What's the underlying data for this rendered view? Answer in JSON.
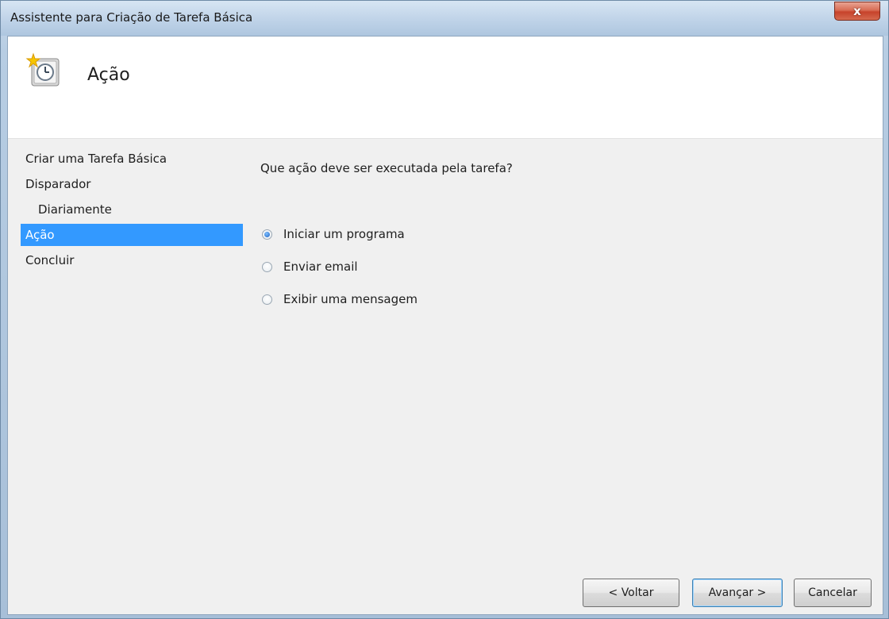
{
  "window": {
    "title": "Assistente para Criação de Tarefa Básica",
    "close_label": "x"
  },
  "header": {
    "icon": "task-clock-icon",
    "title": "Ação"
  },
  "nav": {
    "items": [
      {
        "label": "Criar uma Tarefa Básica",
        "active": false
      },
      {
        "label": "Disparador",
        "active": false
      },
      {
        "label": "Diariamente",
        "active": false
      },
      {
        "label": "Ação",
        "active": true
      },
      {
        "label": "Concluir",
        "active": false
      }
    ]
  },
  "main": {
    "question": "Que ação deve ser executada pela tarefa?",
    "options": [
      {
        "label": "Iniciar um programa",
        "checked": true
      },
      {
        "label": "Enviar email",
        "checked": false
      },
      {
        "label": "Exibir uma mensagem",
        "checked": false
      }
    ]
  },
  "buttons": {
    "back": "< Voltar",
    "next": "Avançar >",
    "cancel": "Cancelar"
  },
  "colors": {
    "selection": "#3399ff",
    "close": "#c7432b"
  }
}
